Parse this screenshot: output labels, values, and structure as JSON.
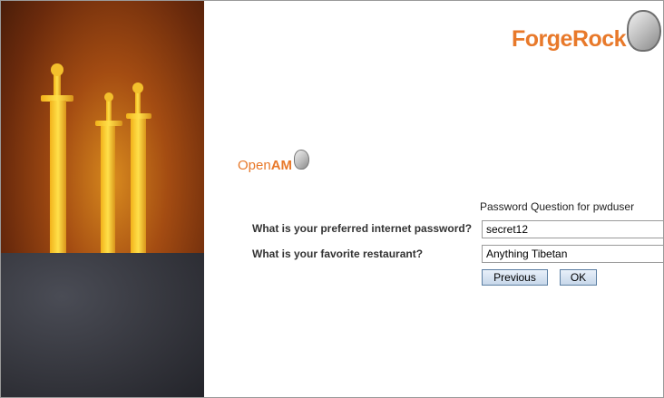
{
  "branding": {
    "company_part1": "Forge",
    "company_part2": "Rock",
    "product_part1": "Open",
    "product_part2": "AM"
  },
  "form": {
    "title": "Password Question for pwduser",
    "questions": [
      {
        "label": "What is your preferred internet password?",
        "value": "secret12"
      },
      {
        "label": "What is your favorite restaurant?",
        "value": "Anything Tibetan"
      }
    ],
    "buttons": {
      "previous": "Previous",
      "ok": "OK"
    }
  },
  "colors": {
    "brand_orange": "#e8792a",
    "button_border": "#5c7fa3"
  },
  "icons": {
    "art": "swords-in-rock-image",
    "logo": "forgerock-stone-icon",
    "product_logo": "openam-stone-icon"
  }
}
